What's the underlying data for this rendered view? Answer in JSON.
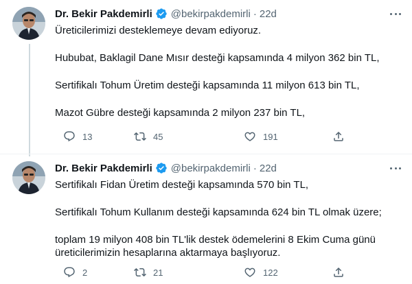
{
  "tweets": [
    {
      "name": "Dr. Bekir Pakdemirli",
      "handle": "@bekirpakdemirli",
      "separator": "·",
      "time": "22d",
      "paragraphs": [
        "Üreticilerimizi desteklemeye devam ediyoruz.",
        "Hububat, Baklagil Dane Mısır desteği kapsamında 4 milyon 362 bin TL,",
        "Sertifikalı Tohum Üretim desteği kapsamında 11 milyon 613 bin TL,",
        "Mazot Gübre desteği kapsamında 2 milyon 237 bin TL,"
      ],
      "replies": "13",
      "retweets": "45",
      "likes": "191"
    },
    {
      "name": "Dr. Bekir Pakdemirli",
      "handle": "@bekirpakdemirli",
      "separator": "·",
      "time": "22d",
      "paragraphs": [
        "Sertifikalı Fidan Üretim desteği kapsamında 570 bin TL,",
        "Sertifikalı Tohum Kullanım desteği kapsamında 624 bin TL olmak üzere;",
        "toplam 19 milyon 408 bin TL'lik destek ödemelerini 8 Ekim Cuma günü üreticilerimizin hesaplarına aktarmaya başlıyoruz."
      ],
      "replies": "2",
      "retweets": "21",
      "likes": "122"
    }
  ],
  "colors": {
    "text": "#0f1419",
    "secondary": "#536471",
    "verified": "#1d9bf0",
    "thread_line": "#cfd9de"
  },
  "icons": [
    "verified-badge-icon",
    "more-icon",
    "reply-icon",
    "retweet-icon",
    "like-icon",
    "share-icon"
  ]
}
